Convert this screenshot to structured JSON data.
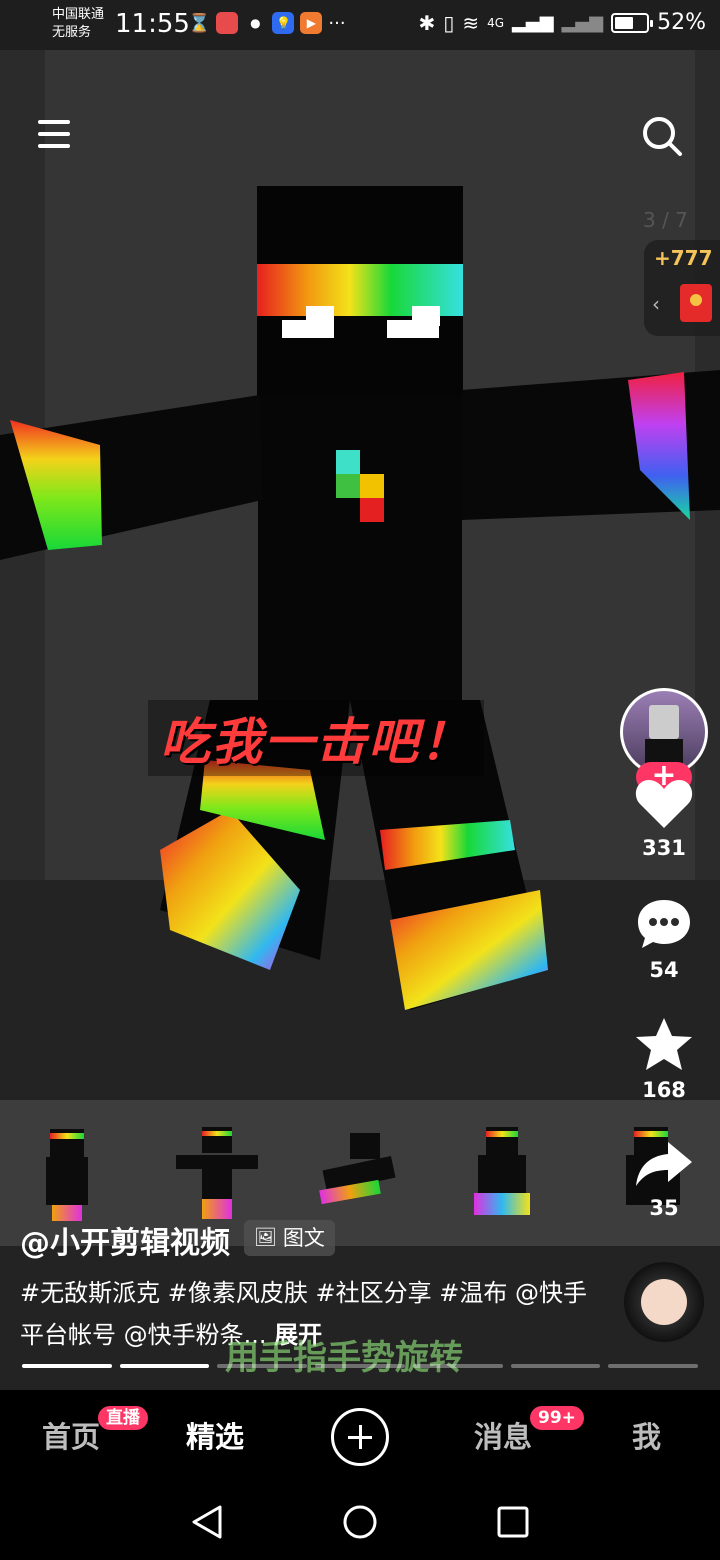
{
  "status_bar": {
    "carrier_line1": "中国联通",
    "carrier_line2": "无服务",
    "time": "11:55",
    "battery_percent": "52%",
    "network": "4G",
    "more": "···"
  },
  "video": {
    "page_counter": "3 / 7",
    "reward_amount": "+777",
    "overlay_caption": "吃我一击吧！",
    "gesture_hint": "用手指手势旋转"
  },
  "actions": {
    "follow": "+",
    "like_count": "331",
    "comment_count": "54",
    "favorite_count": "168",
    "share_count": "35"
  },
  "post": {
    "author": "@小开剪辑视频",
    "type_badge": "图文",
    "description": "#无敌斯派克 #像素风皮肤 #社区分享 #温布 @快手平台帐号 @快手粉条...",
    "expand_label": "展开",
    "progress": {
      "total_pages": 7,
      "completed_pages": 2
    }
  },
  "bottom_nav": {
    "home": "首页",
    "home_badge": "直播",
    "featured": "精选",
    "messages": "消息",
    "messages_badge": "99+",
    "me": "我"
  },
  "icons": {
    "menu": "hamburger-icon",
    "search": "search-icon",
    "like": "heart-icon",
    "comment": "comment-icon",
    "favorite": "star-icon",
    "share": "share-icon",
    "back": "back-triangle-icon",
    "home_sys": "home-circle-icon",
    "recents": "recents-square-icon"
  },
  "colors": {
    "accent": "#fe3666",
    "caption_red": "#ff3b3b",
    "reward_gold": "#f5c35a"
  }
}
